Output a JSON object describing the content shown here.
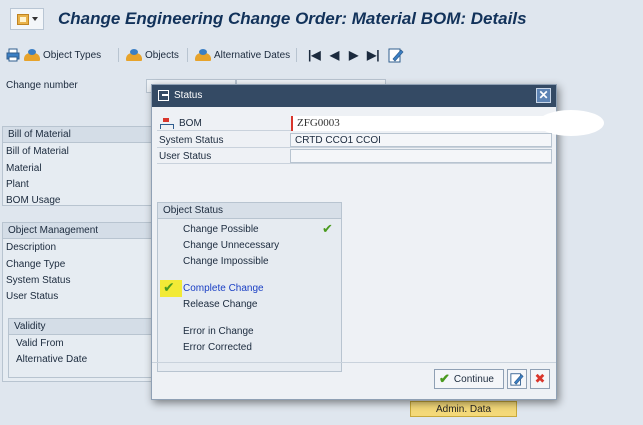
{
  "window": {
    "title": "Change Engineering Change Order: Material BOM: Details"
  },
  "toolbar": {
    "object_types": "Object Types",
    "objects": "Objects",
    "alternative_dates": "Alternative Dates"
  },
  "main": {
    "change_number_label": "Change number",
    "bill_of_material": {
      "header": "Bill of Material",
      "rows": [
        "Bill of Material",
        "Material",
        "Plant",
        "BOM Usage"
      ]
    },
    "object_management": {
      "header": "Object Management",
      "rows": [
        "Description",
        "Change Type",
        "System Status",
        "User Status"
      ]
    },
    "validity": {
      "header": "Validity",
      "rows": [
        "Valid From",
        "Alternative Date"
      ]
    },
    "admin_data": "Admin. Data"
  },
  "dialog": {
    "title": "Status",
    "bom_label": "BOM",
    "bom_value": "ZFG0003",
    "system_status_label": "System Status",
    "system_status_value": "CRTD CCO1 CCOI",
    "user_status_label": "User Status",
    "user_status_value": "",
    "object_status": {
      "header": "Object Status",
      "items": [
        "Change Possible",
        "Change Unnecessary",
        "Change Impossible",
        "Complete Change",
        "Release Change",
        "Error in Change",
        "Error Corrected"
      ]
    },
    "continue_label": "Continue"
  }
}
